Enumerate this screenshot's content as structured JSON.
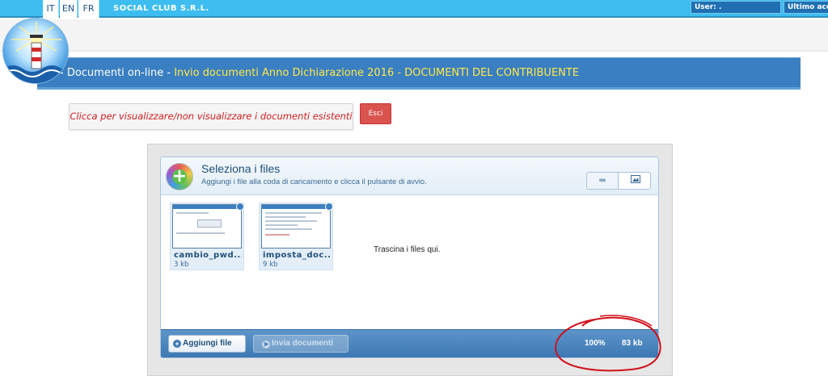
{
  "header": {
    "languages": [
      "IT",
      "EN",
      "FR"
    ],
    "company": "SOCIAL CLUB S.R.L.",
    "user_label": "User:",
    "user_value": ".",
    "last_access_label": "Ultimo acce"
  },
  "title_bar": {
    "prefix": "- Documenti on-line - ",
    "highlight": "Invio documenti Anno Dichiarazione 2016 - DOCUMENTI DEL CONTRIBUENTE"
  },
  "actions": {
    "toggle_label": "Clicca per visualizzare/non visualizzare i documenti esistenti",
    "exit_label": "Esci"
  },
  "uploader": {
    "title": "Seleziona i files",
    "subtitle": "Aggiungi i file alla coda di caricamento e clicca il pulsante di avvio.",
    "drop_message": "Trascina i files qui.",
    "files": [
      {
        "name": "cambio_pwd....",
        "size": "3 kb"
      },
      {
        "name": "imposta_doc....",
        "size": "9 kb"
      }
    ],
    "add_label": "Aggiungi file",
    "send_label": "Invia documenti",
    "percent": "100%",
    "total_size": "83 kb"
  },
  "colors": {
    "top_bar": "#3dbdf0",
    "title_bar": "#3a7fc1",
    "title_accent": "#ffe84a",
    "toggle_text": "#cc1f1f",
    "exit_button": "#d9534f",
    "annotation": "#d0101a"
  }
}
